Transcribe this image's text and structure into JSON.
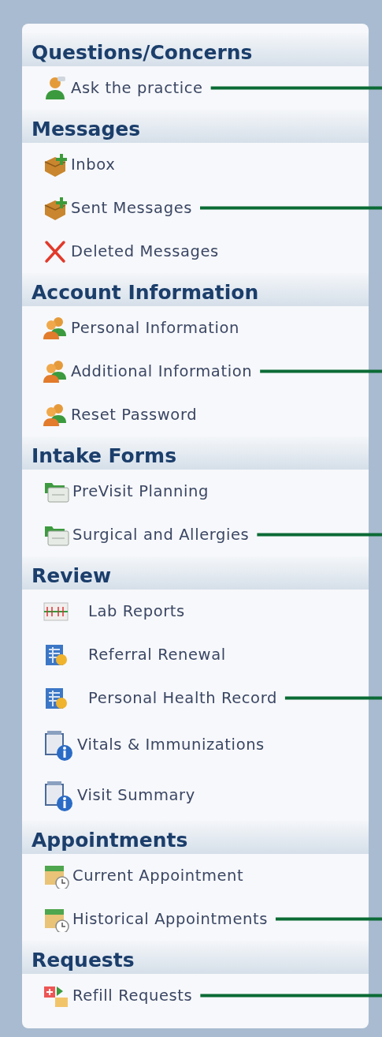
{
  "sections": [
    {
      "title": "Questions/Concerns",
      "items": [
        {
          "label": "Ask the practice",
          "kind": "person",
          "leader": true
        }
      ]
    },
    {
      "title": "Messages",
      "items": [
        {
          "label": "Inbox",
          "kind": "box",
          "leader": false
        },
        {
          "label": "Sent Messages",
          "kind": "box",
          "leader": true
        },
        {
          "label": "Deleted Messages",
          "kind": "delete",
          "leader": false
        }
      ]
    },
    {
      "title": "Account Information",
      "items": [
        {
          "label": "Personal Information",
          "kind": "people",
          "leader": false
        },
        {
          "label": "Additional Information",
          "kind": "people",
          "leader": true
        },
        {
          "label": "Reset Password",
          "kind": "people",
          "leader": false
        }
      ]
    },
    {
      "title": "Intake Forms",
      "items": [
        {
          "label": "PreVisit Planning",
          "kind": "folder",
          "leader": false
        },
        {
          "label": "Surgical and Allergies",
          "kind": "folder",
          "leader": true
        }
      ]
    },
    {
      "title": "Review",
      "items": [
        {
          "label": "Lab Reports",
          "kind": "chart",
          "leader": false
        },
        {
          "label": "Referral Renewal",
          "kind": "table",
          "leader": false
        },
        {
          "label": "Personal Health Record",
          "kind": "table",
          "leader": true
        },
        {
          "label": "Vitals & Immunizations",
          "kind": "info",
          "leader": false
        },
        {
          "label": "Visit Summary",
          "kind": "info",
          "leader": false
        }
      ]
    },
    {
      "title": "Appointments",
      "items": [
        {
          "label": "Current Appointment",
          "kind": "calendar",
          "leader": false
        },
        {
          "label": "Historical Appointments",
          "kind": "calendar",
          "leader": true
        }
      ]
    },
    {
      "title": "Requests",
      "items": [
        {
          "label": "Refill Requests",
          "kind": "refill",
          "leader": true
        }
      ]
    }
  ]
}
